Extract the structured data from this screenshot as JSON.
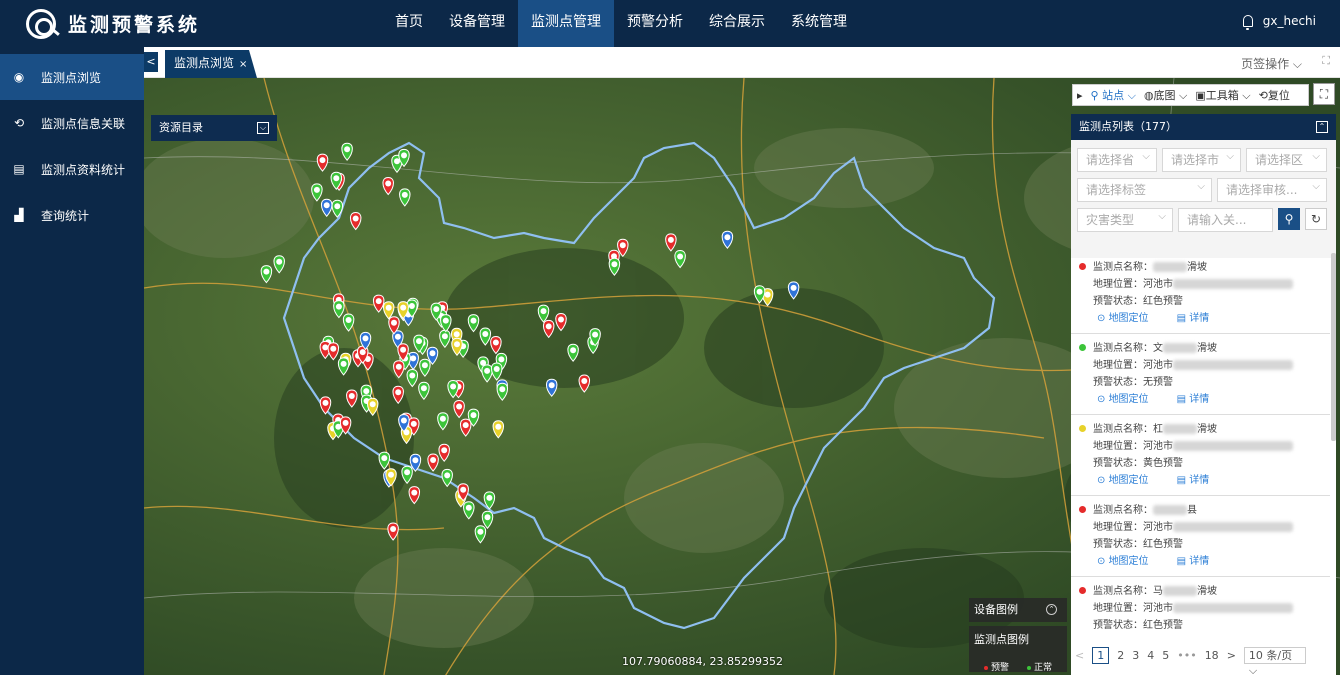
{
  "header": {
    "title": "监测预警系统",
    "nav": [
      "首页",
      "设备管理",
      "监测点管理",
      "预警分析",
      "综合展示",
      "系统管理"
    ],
    "active_nav": 2,
    "user": "gx_hechi"
  },
  "sidebar": {
    "items": [
      {
        "label": "监测点浏览",
        "icon": "eye-icon"
      },
      {
        "label": "监测点信息关联",
        "icon": "refresh-link-icon"
      },
      {
        "label": "监测点资料统计",
        "icon": "document-list-icon"
      },
      {
        "label": "查询统计",
        "icon": "bar-chart-icon"
      }
    ]
  },
  "tabs": {
    "prev": "<",
    "active": "监测点浏览",
    "close": "×",
    "ops": "页签操作",
    "expand": "⛶"
  },
  "map": {
    "resource_dir": "资源目录",
    "coords": "107.79060884, 23.85299352",
    "device_legend": "设备图例",
    "point_legend": "监测点图例",
    "legend_warn": "预警",
    "legend_normal": "正常",
    "colors": {
      "red": "#e52b2b",
      "green": "#3cc43a",
      "yellow": "#e7d22a",
      "blue": "#2f73d8",
      "boundary": "#8fbff0"
    }
  },
  "toolbar": {
    "station": "站点",
    "basemap": "底图",
    "toolbox": "工具箱",
    "reset": "复位"
  },
  "panel": {
    "title": "监测点列表（177）",
    "filters": {
      "province": "请选择省",
      "city": "请选择市",
      "district": "请选择区",
      "tag": "请选择标签",
      "review": "请选择审核...",
      "disaster": "灾害类型",
      "keyword_placeholder": "请输入关..."
    },
    "labels": {
      "name": "监测点名称：",
      "location": "地理位置：",
      "status": "预警状态：",
      "locate": "地图定位",
      "detail": "详情"
    },
    "items": [
      {
        "name_suffix": "滑坡",
        "location_prefix": "河池市",
        "status": "红色预警",
        "color": "#e52b2b"
      },
      {
        "name_prefix": "文",
        "name_suffix": "滑坡",
        "location_prefix": "河池市",
        "status": "无预警",
        "color": "#3cc43a"
      },
      {
        "name_prefix": "杠",
        "name_suffix": "滑坡",
        "location_prefix": "河池市",
        "status": "黄色预警",
        "color": "#e7d22a"
      },
      {
        "name_suffix": "县",
        "location_prefix": "河池市",
        "status": "红色预警",
        "color": "#e52b2b"
      },
      {
        "name_prefix": "马",
        "name_suffix": "滑坡",
        "location_prefix": "河池市",
        "status": "红色预警",
        "color": "#e52b2b"
      }
    ]
  },
  "pager": {
    "prev": "<",
    "pages": [
      "1",
      "2",
      "3",
      "4",
      "5",
      "•••",
      "18"
    ],
    "next": ">",
    "size": "10 条/页"
  }
}
